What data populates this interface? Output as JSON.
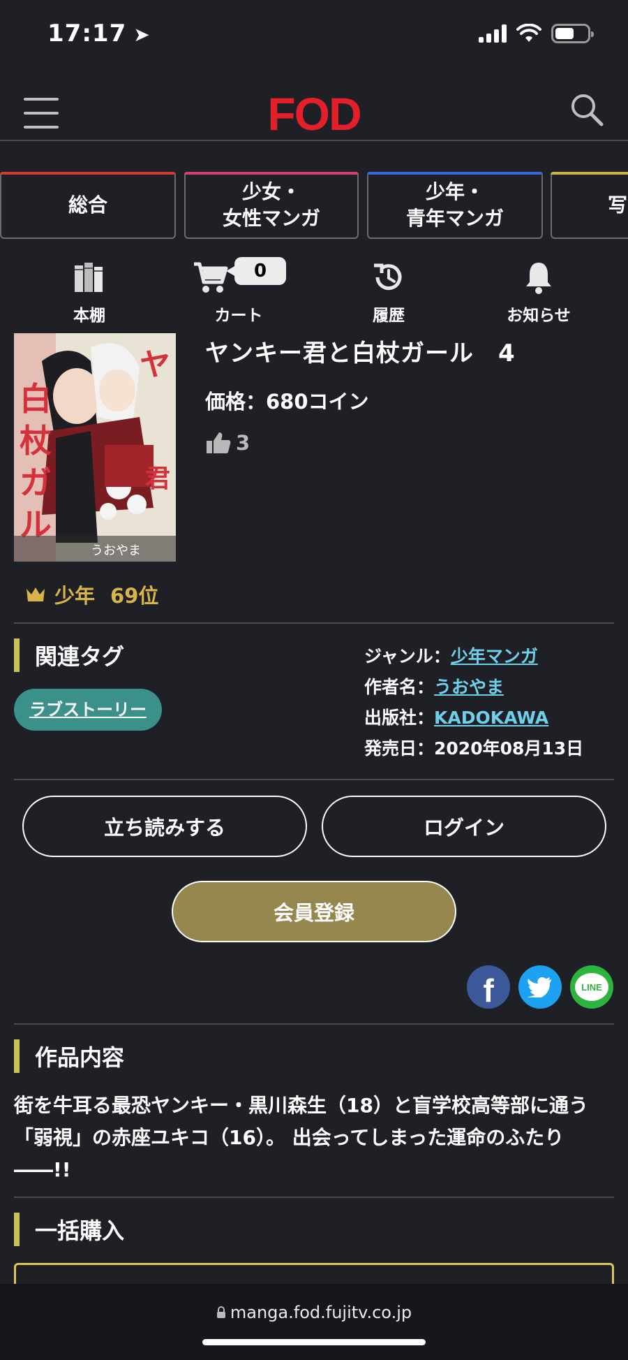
{
  "status_bar": {
    "time": "17:17"
  },
  "header": {
    "logo": "FOD"
  },
  "categories": [
    {
      "label": "総合",
      "color": "#d23a3a"
    },
    {
      "label": "少女・\n女性マンガ",
      "color": "#d0417a"
    },
    {
      "label": "少年・\n青年マンガ",
      "color": "#3a6ad8"
    },
    {
      "label": "写",
      "color": "#c9b24a"
    }
  ],
  "nav": {
    "bookshelf": "本棚",
    "cart": "カート",
    "cart_count": "0",
    "history": "履歴",
    "notifications": "お知らせ"
  },
  "book": {
    "title": "ヤンキー君と白杖ガール　4",
    "price": "価格：680コイン",
    "likes": "3",
    "rank_category": "少年",
    "rank": "69位",
    "cover_text": "ヤンキー君と白杖ガール",
    "cover_author": "うおやま"
  },
  "tags": {
    "heading": "関連タグ",
    "items": [
      "ラブストーリー"
    ]
  },
  "meta": {
    "genre_label": "ジャンル：",
    "genre": "少年マンガ",
    "author_label": "作者名：",
    "author": "うおやま",
    "publisher_label": "出版社：",
    "publisher": "KADOKAWA",
    "release_label": "発売日：",
    "release": "2020年08月13日"
  },
  "actions": {
    "preview": "立ち読みする",
    "login": "ログイン",
    "register": "会員登録"
  },
  "share": {
    "line": "LINE",
    "colors": {
      "facebook": "#3b5998",
      "twitter": "#1da1f2",
      "line": "#2fb33f"
    }
  },
  "description": {
    "heading": "作品内容",
    "text": "街を牛耳る最恐ヤンキー・黒川森生（18）と盲学校高等部に通う「弱視」の赤座ユキコ（16）。 出会ってしまった運命のふたり――!!"
  },
  "bulk": {
    "heading": "一括購入"
  },
  "browser": {
    "url": "manga.fod.fujitv.co.jp"
  }
}
